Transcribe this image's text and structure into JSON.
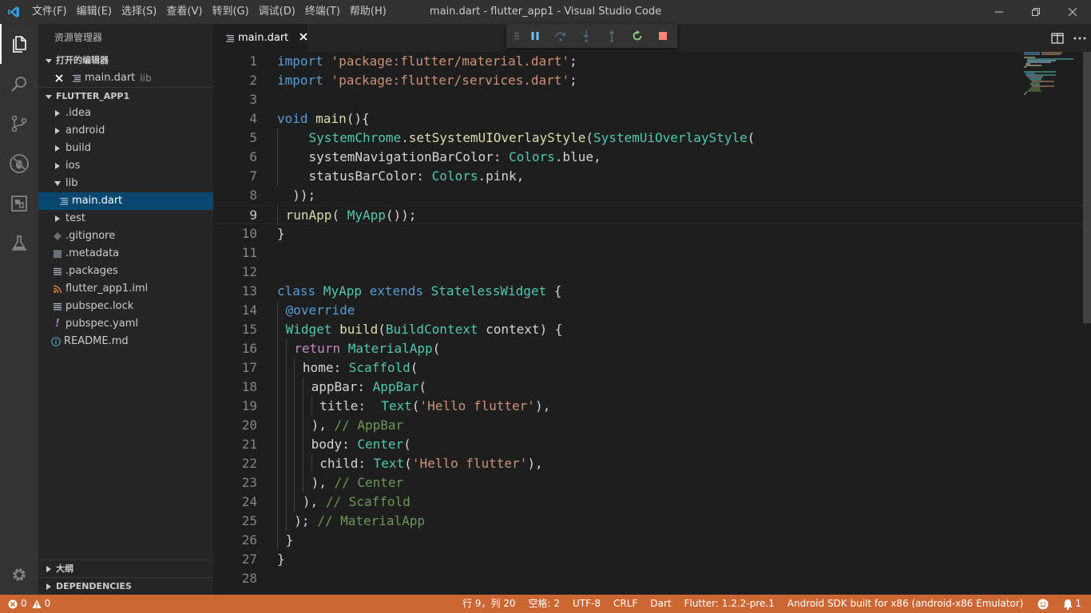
{
  "window": {
    "title": "main.dart - flutter_app1 - Visual Studio Code",
    "menu": [
      "文件(F)",
      "编辑(E)",
      "选择(S)",
      "查看(V)",
      "转到(G)",
      "调试(D)",
      "终端(T)",
      "帮助(H)"
    ]
  },
  "activity_bar": {
    "items": [
      "files-icon",
      "search-icon",
      "source-control-icon",
      "debug-icon",
      "extensions-icon",
      "test-icon"
    ],
    "bottom": "gear-icon"
  },
  "sidebar": {
    "title": "资源管理器",
    "open_editors": {
      "header": "打开的编辑器",
      "items": [
        {
          "name": "main.dart",
          "folder": "lib"
        }
      ]
    },
    "project": {
      "header": "FLUTTER_APP1",
      "tree": [
        {
          "label": ".idea",
          "type": "folder"
        },
        {
          "label": "android",
          "type": "folder"
        },
        {
          "label": "build",
          "type": "folder"
        },
        {
          "label": "ios",
          "type": "folder"
        },
        {
          "label": "lib",
          "type": "folder-open"
        },
        {
          "label": "main.dart",
          "type": "file",
          "selected": true
        },
        {
          "label": "test",
          "type": "folder"
        },
        {
          "label": ".gitignore",
          "type": "file"
        },
        {
          "label": ".metadata",
          "type": "file"
        },
        {
          "label": ".packages",
          "type": "file"
        },
        {
          "label": "flutter_app1.iml",
          "type": "file"
        },
        {
          "label": "pubspec.lock",
          "type": "file"
        },
        {
          "label": "pubspec.yaml",
          "type": "file"
        },
        {
          "label": "README.md",
          "type": "file"
        }
      ]
    },
    "outline_header": "大纲",
    "dependencies_header": "DEPENDENCIES"
  },
  "tabs": [
    {
      "label": "main.dart",
      "active": true
    }
  ],
  "debug_toolbar": [
    "pause-icon",
    "step-over-icon",
    "step-into-icon",
    "step-out-icon",
    "restart-icon",
    "stop-icon"
  ],
  "editor": {
    "current_line": 9,
    "lines": [
      "1",
      "2",
      "3",
      "4",
      "5",
      "6",
      "7",
      "8",
      "9",
      "10",
      "11",
      "12",
      "13",
      "14",
      "15",
      "16",
      "17",
      "18",
      "19",
      "20",
      "21",
      "22",
      "23",
      "24",
      "25",
      "26",
      "27",
      "28"
    ],
    "code": {
      "l1a": "import",
      "l1b": " 'package:flutter/material.dart'",
      "l1c": ";",
      "l2a": "import",
      "l2b": " 'package:flutter/services.dart'",
      "l2c": ";",
      "l4a": "void",
      "l4b": " main",
      "l4c": "(){",
      "l5a": "SystemChrome",
      "l5b": ".",
      "l5c": "setSystemUIOverlayStyle",
      "l5d": "(",
      "l5e": "SystemUiOverlayStyle",
      "l5f": "(",
      "l6a": "systemNavigationBarColor: ",
      "l6b": "Colors",
      "l6c": ".blue,",
      "l7a": "statusBarColor: ",
      "l7b": "Colors",
      "l7c": ".pink,",
      "l8a": "));",
      "l9a": "runApp",
      "l9b": "( ",
      "l9c": "MyApp",
      "l9d": "());",
      "l10a": "}",
      "l13a": "class",
      "l13b": " MyApp",
      "l13c": " extends",
      "l13d": " StatelessWidget",
      "l13e": " {",
      "l14a": "@override",
      "l15a": "Widget",
      "l15b": " build",
      "l15c": "(",
      "l15d": "BuildContext",
      "l15e": " context) {",
      "l16a": "return",
      "l16b": " MaterialApp",
      "l16c": "(",
      "l17a": "home: ",
      "l17b": "Scaffold",
      "l17c": "(",
      "l18a": "appBar: ",
      "l18b": "AppBar",
      "l18c": "(",
      "l19a": "title:  ",
      "l19b": "Text",
      "l19c": "(",
      "l19d": "'Hello flutter'",
      "l19e": "),",
      "l20a": "), ",
      "l20b": "// AppBar",
      "l21a": "body: ",
      "l21b": "Center",
      "l21c": "(",
      "l22a": "child: ",
      "l22b": "Text",
      "l22c": "(",
      "l22d": "'Hello flutter'",
      "l22e": "),",
      "l23a": "), ",
      "l23b": "// Center",
      "l24a": "), ",
      "l24b": "// Scaffold",
      "l25a": "); ",
      "l25b": "// MaterialApp",
      "l26a": "}",
      "l27a": "}"
    }
  },
  "status_bar": {
    "errors": "0",
    "warnings": "0",
    "position": "行 9，列 20",
    "spaces": "空格: 2",
    "encoding": "UTF-8",
    "eol": "CRLF",
    "language": "Dart",
    "flutter": "Flutter: 1.2.2-pre.1",
    "device": "Android SDK built for x86 (android-x86 Emulator)",
    "background_color": "#cc6633"
  }
}
